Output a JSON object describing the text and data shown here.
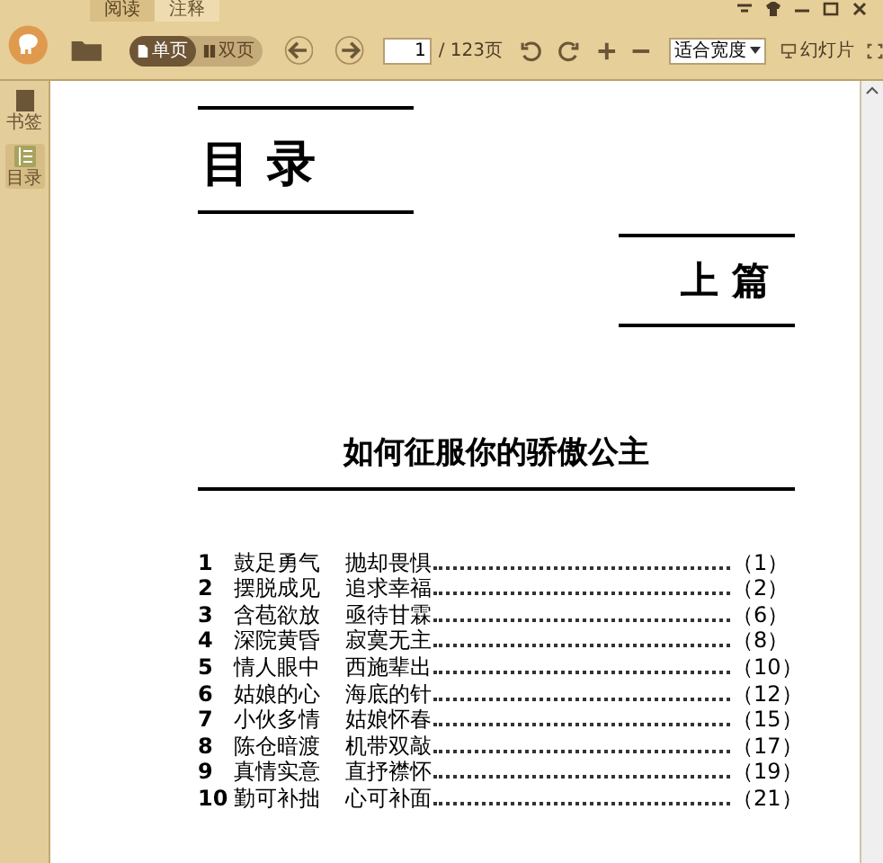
{
  "tabs": [
    {
      "label": "阅读",
      "selected": true
    },
    {
      "label": "注释",
      "selected": false
    }
  ],
  "toolbar": {
    "view_modes": [
      {
        "label": "单页",
        "selected": true
      },
      {
        "label": "双页",
        "selected": false
      }
    ],
    "page_input": "1",
    "page_total": "/ 123页",
    "zoom_select": "适合宽度",
    "slideshow": "幻灯片"
  },
  "sidebar": {
    "items": [
      {
        "label": "书签",
        "selected": false
      },
      {
        "label": "目录",
        "selected": true
      }
    ]
  },
  "document": {
    "heading": "目 录",
    "part": "上 篇",
    "section_title": "如何征服你的骄傲公主",
    "entries": [
      {
        "number": "1",
        "title": "鼓足勇气",
        "subtitle": "抛却畏惧",
        "page": "（1）"
      },
      {
        "number": "2",
        "title": "摆脱成见",
        "subtitle": "追求幸福",
        "page": "（2）"
      },
      {
        "number": "3",
        "title": "含苞欲放",
        "subtitle": "亟待甘霖",
        "page": "（6）"
      },
      {
        "number": "4",
        "title": "深院黄昏",
        "subtitle": "寂寞无主",
        "page": "（8）"
      },
      {
        "number": "5",
        "title": "情人眼中",
        "subtitle": "西施辈出",
        "page": "（10）"
      },
      {
        "number": "6",
        "title": "姑娘的心",
        "subtitle": "海底的针",
        "page": "（12）"
      },
      {
        "number": "7",
        "title": "小伙多情",
        "subtitle": "姑娘怀春",
        "page": "（15）"
      },
      {
        "number": "8",
        "title": "陈仓暗渡",
        "subtitle": "机带双敲",
        "page": "（17）"
      },
      {
        "number": "9",
        "title": "真情实意",
        "subtitle": "直抒襟怀",
        "page": "（19）"
      },
      {
        "number": "10",
        "title": "勤可补拙",
        "subtitle": "心可补面",
        "page": "（21）"
      }
    ]
  }
}
